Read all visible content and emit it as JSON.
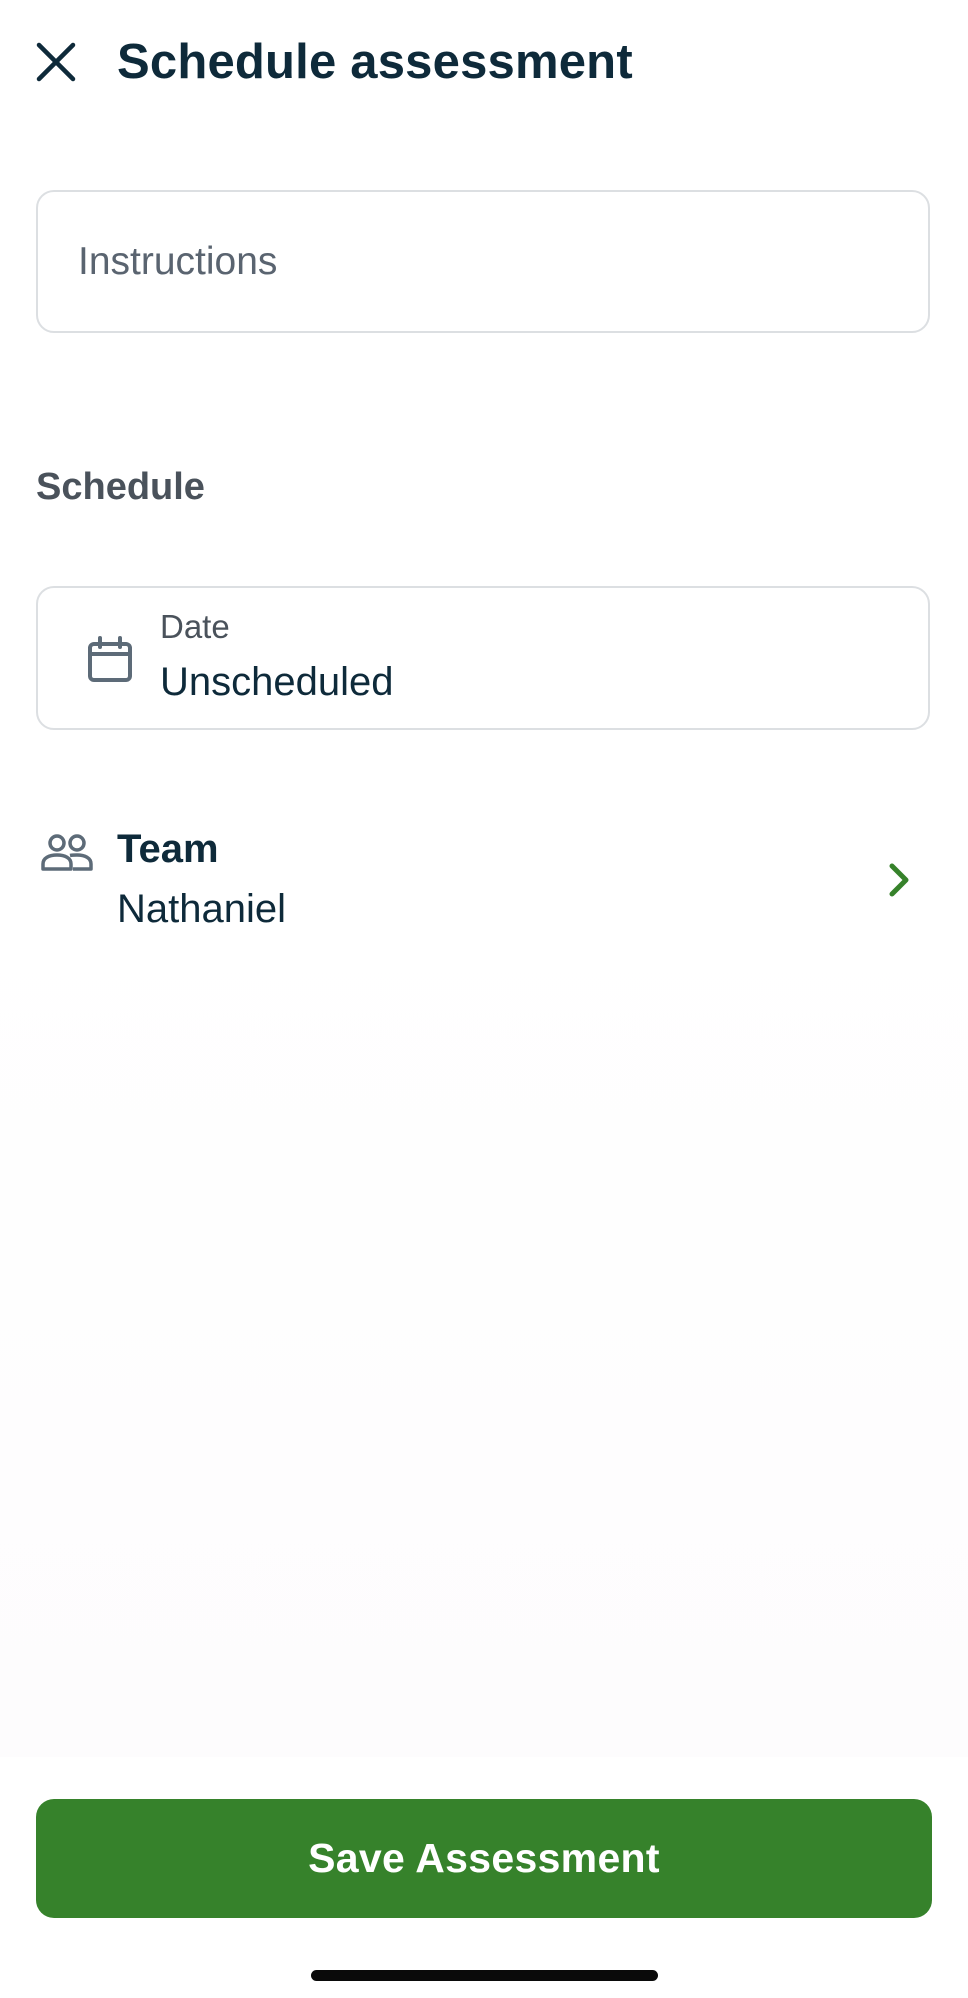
{
  "header": {
    "title": "Schedule assessment",
    "close_icon": "close-icon"
  },
  "instructions": {
    "placeholder": "Instructions",
    "value": ""
  },
  "schedule": {
    "section_label": "Schedule",
    "date": {
      "icon": "calendar-icon",
      "label": "Date",
      "value": "Unscheduled"
    },
    "team": {
      "icon": "team-icon",
      "label": "Team",
      "value": "Nathaniel",
      "chevron_icon": "chevron-right-icon"
    }
  },
  "footer": {
    "save_label": "Save Assessment"
  },
  "colors": {
    "primary": "#36822b",
    "text": "#0e2a3a",
    "muted": "#4a525b",
    "icon": "#5d6b78",
    "border": "#dcdfe2"
  }
}
